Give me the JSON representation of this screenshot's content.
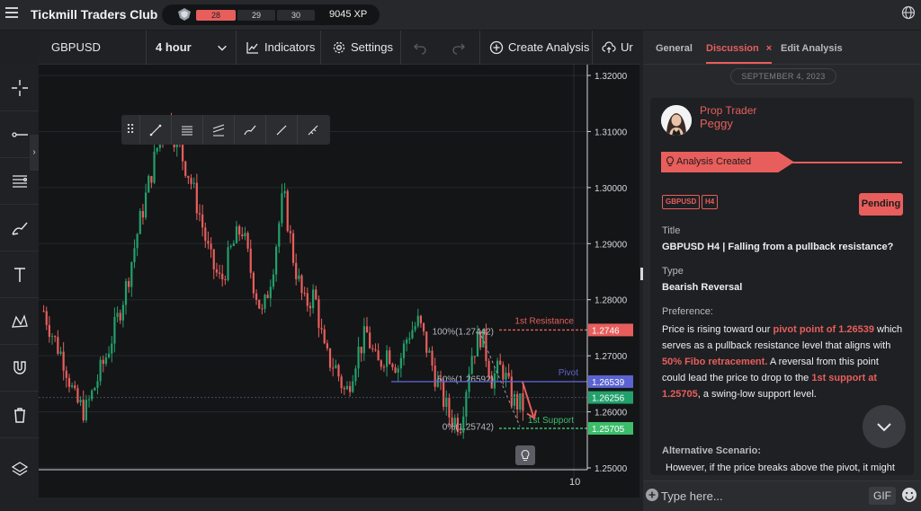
{
  "app": {
    "title": "Tickmill Traders Club",
    "xp": {
      "level_segments": [
        "28",
        "29",
        "30"
      ],
      "value": "9045 XP"
    }
  },
  "toolbar": {
    "symbol": "GBPUSD",
    "timeframe": "4 hour",
    "indicators": "Indicators",
    "settings": "Settings",
    "create_analysis": "Create Analysis",
    "upload": "Ur"
  },
  "chart_data": {
    "type": "candlestick",
    "symbol": "GBPUSD",
    "timeframe": "4 hour",
    "ylim": [
      1.25,
      1.32
    ],
    "y_ticks": [
      "1.32000",
      "1.31000",
      "1.30000",
      "1.29000",
      "1.28000",
      "1.27000",
      "1.26000",
      "1.25000"
    ],
    "x_ticks": [
      "10"
    ],
    "price_path": [
      1.278,
      1.273,
      1.269,
      1.262,
      1.26,
      1.265,
      1.27,
      1.276,
      1.283,
      1.292,
      1.3,
      1.308,
      1.312,
      1.307,
      1.302,
      1.295,
      1.287,
      1.283,
      1.289,
      1.293,
      1.284,
      1.277,
      1.286,
      1.299,
      1.287,
      1.279,
      1.281,
      1.27,
      1.268,
      1.263,
      1.27,
      1.274,
      1.268,
      1.271,
      1.268,
      1.274,
      1.276,
      1.27,
      1.264,
      1.259,
      1.258,
      1.27,
      1.274,
      1.266,
      1.268,
      1.262,
      1.261
    ],
    "fibonacci": [
      {
        "label": "100%(1.27442)",
        "price": 1.27442
      },
      {
        "label": "50%(1.26592)",
        "price": 1.26592
      },
      {
        "label": "0%(1.25742)",
        "price": 1.25742
      }
    ],
    "levels": [
      {
        "name": "1st Resistance",
        "price": 1.2746,
        "tag": "1.2746",
        "color": "#e85e5c"
      },
      {
        "name": "Pivot",
        "price": 1.26539,
        "tag": "1.26539",
        "color": "#5b63d1"
      },
      {
        "name": "1st Support",
        "price": 1.25705,
        "tag": "1.25705",
        "color": "#3cbd6a"
      }
    ],
    "current_price": {
      "tag": "1.26256",
      "price": 1.26256,
      "color": "#22a06b"
    }
  },
  "panel": {
    "tabs": [
      "General",
      "Discussion",
      "Edit Analysis"
    ],
    "close_tab": "×",
    "date": "SEPTEMBER 4, 2023",
    "post": {
      "author_role": "Prop Trader",
      "author_name": "Peggy",
      "event": "Analysis Created",
      "tags": [
        "GBPUSD",
        "H4"
      ],
      "status": "Pending",
      "title_label": "Title",
      "title": "GBPUSD H4 | Falling from a pullback resistance?",
      "type_label": "Type",
      "type": "Bearish Reversal",
      "preference_label": "Preference:",
      "preference": {
        "p1": "Price is rising toward our ",
        "h1": "pivot point of 1.26539",
        "p2": " which serves as a pullback resistance level that aligns with ",
        "h2": "50% Fibo retracement.",
        "p3": "  A  reversal from this point could lead the price to drop to the ",
        "h3": "1st support at 1.25705",
        "p4": ", a swing-low support level."
      },
      "alt_label": "Alternative Scenario:",
      "alt_text": "However, if the price breaks above the pivot, it might"
    },
    "composer": {
      "placeholder": "Type here...",
      "gif": "GIF"
    }
  }
}
